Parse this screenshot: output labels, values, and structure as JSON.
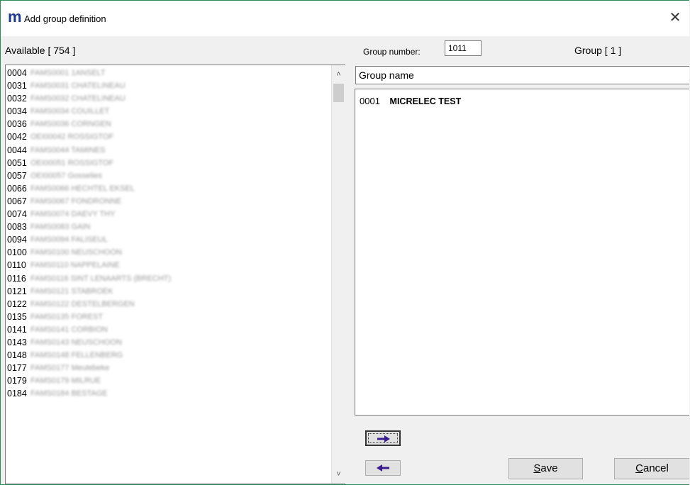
{
  "window": {
    "logo": "m",
    "title": "Add group definition",
    "close_glyph": "✕"
  },
  "header": {
    "available_label": "Available [ 754 ]",
    "group_number_label": "Group number:",
    "group_number_value": "1011",
    "group_count_label": "Group [ 1 ]"
  },
  "available_list": [
    {
      "code": "0004",
      "name": "FAMS0001 1ANSELT"
    },
    {
      "code": "0031",
      "name": "FAMS0031 CHATELINEAU"
    },
    {
      "code": "0032",
      "name": "FAMS0032 CHATELINEAU"
    },
    {
      "code": "0034",
      "name": "FAMS0034 COUILLET"
    },
    {
      "code": "0036",
      "name": "FAMS0036 CORNGEN"
    },
    {
      "code": "0042",
      "name": "OEI00042 ROSSIGTOF"
    },
    {
      "code": "0044",
      "name": "FAMS0044 TAMINES"
    },
    {
      "code": "0051",
      "name": "OEI00051 ROSSIGTOF"
    },
    {
      "code": "0057",
      "name": "OEI00057 Gosselies"
    },
    {
      "code": "0066",
      "name": "FAMS0066 HECHTEL EKSEL"
    },
    {
      "code": "0067",
      "name": "FAMS0067 FONDRONNE"
    },
    {
      "code": "0074",
      "name": "FAMS0074 DAEVY THY"
    },
    {
      "code": "0083",
      "name": "FAMS0083 GAIN"
    },
    {
      "code": "0094",
      "name": "FAMS0094 FALISEUL"
    },
    {
      "code": "0100",
      "name": "FAMS0100 NEUSCHOON"
    },
    {
      "code": "0110",
      "name": "FAMS0110 NAPPELAINE"
    },
    {
      "code": "0116",
      "name": "FAMS0116 SINT LENAARTS (BRECHT)"
    },
    {
      "code": "0121",
      "name": "FAMS0121 STABROEK"
    },
    {
      "code": "0122",
      "name": "FAMS0122 DESTELBERGEN"
    },
    {
      "code": "0135",
      "name": "FAMS0135 FOREST"
    },
    {
      "code": "0141",
      "name": "FAMS0141 CORBION"
    },
    {
      "code": "0143",
      "name": "FAMS0143 NEUSCHOON"
    },
    {
      "code": "0148",
      "name": "FAMS0148 FELLENBERG"
    },
    {
      "code": "0177",
      "name": "FAMS0177 Meulebeke"
    },
    {
      "code": "0179",
      "name": "FAMS0179 MILRUE"
    },
    {
      "code": "0184",
      "name": "FAMS0184 BESTAGE"
    }
  ],
  "group": {
    "name_placeholder": "Group name",
    "items": [
      {
        "code": "0001",
        "name": "MICRELEC TEST"
      }
    ]
  },
  "buttons": {
    "save_mnemonic": "S",
    "save_rest": "ave",
    "cancel_mnemonic": "C",
    "cancel_rest": "ancel"
  },
  "colors": {
    "logo": "#1f3a8a",
    "arrow": "#3b1c8c",
    "window_border": "#2e8b57"
  }
}
